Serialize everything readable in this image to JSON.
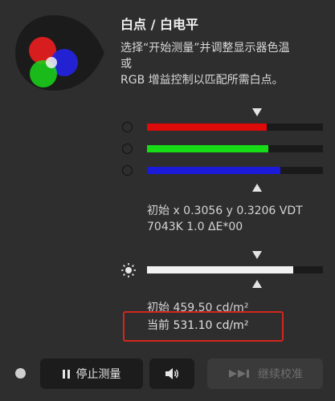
{
  "panel": {
    "title": "白点 / 白电平",
    "instructions": [
      "选择“开始测量”并调整显示器色温",
      "或",
      "RGB 增益控制以匹配所需白点。"
    ]
  },
  "rgb_sliders": [
    {
      "name": "red",
      "color": "#dd0a0a",
      "level": 0.68
    },
    {
      "name": "green",
      "color": "#17dd17",
      "level": 0.69
    },
    {
      "name": "blue",
      "color": "#1a1ad8",
      "level": 0.76
    }
  ],
  "white_point": {
    "line1": "初始 x 0.3056 y 0.3206 VDT",
    "line2": "7043K 1.0 ΔE*00"
  },
  "brightness_slider": {
    "level": 0.83,
    "color": "#f2f2f2"
  },
  "luminance": {
    "initial": "初始 459.50 cd/m²",
    "current": "当前 531.10 cd/m²"
  },
  "footer": {
    "stop_label": "停止测量",
    "continue_label": "继续校准"
  },
  "icons": [
    "rgb-logo-icon",
    "pointer-down-icon",
    "pointer-up-icon",
    "sun-icon",
    "pause-icon",
    "speaker-icon",
    "skip-forward-icon"
  ]
}
